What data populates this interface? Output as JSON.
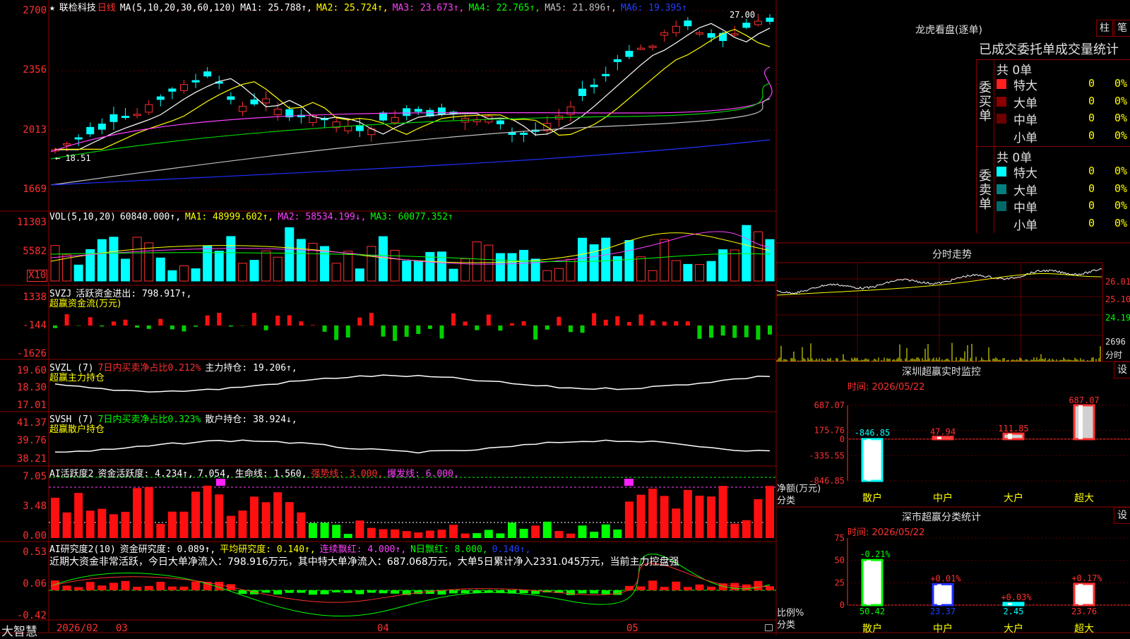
{
  "app": {
    "brand": "大智慧",
    "price_labels": {
      "main_top": "2700",
      "vol_mult": "X10"
    }
  },
  "main": {
    "star": "★",
    "name": "联检科技",
    "period": "日线",
    "ma_params": "MA(5,10,20,30,60,120)",
    "ma1": "MA1: 25.788↑,",
    "ma2": "MA2: 25.724↑,",
    "ma3": "MA3: 23.673↑,",
    "ma4": "MA4: 22.765↑,",
    "ma5": "MA5: 21.896↑,",
    "ma6": "MA6: 19.395↑",
    "yticks": [
      "2700",
      "2356",
      "2013",
      "1669"
    ],
    "high_label": "27.00",
    "low_label": "← 18.51"
  },
  "vol": {
    "params": "VOL(5,10,20)",
    "val": "60840.000↑,",
    "ma1": "MA1: 48999.602↑,",
    "ma2": "MA2: 58534.199↓,",
    "ma3": "MA3: 60077.352↑",
    "yticks": [
      "11303",
      "5582"
    ],
    "mult": "X10"
  },
  "svzj": {
    "params": "SVZJ",
    "label": "活跃资金进出: 798.917↑,",
    "sub": "超赢资金流(万元)",
    "yticks": [
      "1338",
      "-144",
      "-1626"
    ]
  },
  "svzl": {
    "params": "SVZL (7)",
    "ratio": "7日内买卖净占比0.212%",
    "hold": "主力持仓: 19.206↑,",
    "sub": "超赢主力持仓",
    "yticks": [
      "19.60",
      "18.30",
      "17.01"
    ]
  },
  "svsh": {
    "params": "SVSH (7)",
    "ratio": "7日内买卖净占比0.323%",
    "hold": "散户持仓: 38.924↓,",
    "sub": "超赢散户持仓",
    "yticks": [
      "41.37",
      "39.76",
      "38.21"
    ]
  },
  "ai1": {
    "params": "AI活跃度2",
    "active": "资金活跃度: 4.234↑,",
    "v2": "7.054,",
    "life": "生命线: 1.560,",
    "strong": "强势线: 3.000,",
    "burst": "爆发线: 6.000,",
    "yticks": [
      "7.05",
      "3.48",
      "0.00"
    ]
  },
  "ai2": {
    "params": "AI研究度2(10)",
    "research": "资金研究度: 0.089↑,",
    "avg": "平均研究度: 0.140↑,",
    "cont": "连续飘红: 4.000↑,",
    "nday": "N日飘红: 8.000,",
    "extra": "0.140↑,",
    "comment": "近期大资金非常活跃，今日大单净流入：798.916万元，其中特大单净流入：687.068万元，大单5日累计净入2331.045万元，当前主力控盘强",
    "yticks": [
      "0.53",
      "0.06",
      "-0.42"
    ]
  },
  "xaxis": {
    "labels": [
      "2026/02",
      "03",
      "04",
      "05"
    ]
  },
  "dragon": {
    "title": "龙虎看盘(逐单)",
    "btn_zhu": "柱",
    "btn_bi": "笔",
    "header": "已成交委托单成交量统计",
    "buy_side": "委买单",
    "sell_side": "委卖单",
    "buy_total": "共 0单",
    "sell_total": "共 0单",
    "buy_rows": [
      {
        "label": "特大",
        "count": "0",
        "pct": "0%",
        "color": "#ff2020"
      },
      {
        "label": "大单",
        "count": "0",
        "pct": "0%",
        "color": "#8b0000"
      },
      {
        "label": "中单",
        "count": "0",
        "pct": "0%",
        "color": "#6e0000"
      },
      {
        "label": "小单",
        "count": "0",
        "pct": "0%",
        "color": "#000000"
      }
    ],
    "sell_rows": [
      {
        "label": "特大",
        "count": "0",
        "pct": "0%",
        "color": "#00ffff"
      },
      {
        "label": "大单",
        "count": "0",
        "pct": "0%",
        "color": "#008080"
      },
      {
        "label": "中单",
        "count": "0",
        "pct": "0%",
        "color": "#006a6a"
      },
      {
        "label": "小单",
        "count": "0",
        "pct": "0%",
        "color": "#000000"
      }
    ]
  },
  "intraday": {
    "title": "分时走势",
    "yticks": [
      "26.01",
      "25.10",
      "24.19"
    ],
    "vol_label": "2696",
    "vol_unit": "分时"
  },
  "sz_monitor": {
    "title": "深圳超赢实时监控",
    "btn": "设",
    "time": "时间: 2026/05/22",
    "yticks": [
      "687.07",
      "175.76",
      "0",
      "-335.55",
      "-846.85"
    ],
    "axis_label": "净额(万元)",
    "axis_sub": "分类",
    "categories": [
      "散户",
      "中户",
      "大户",
      "超大"
    ],
    "values": [
      -846.85,
      47.94,
      111.85,
      687.07
    ],
    "value_labels": [
      "-846.85",
      "47.94",
      "111.85",
      "687.07"
    ]
  },
  "sz_class": {
    "title": "深市超赢分类统计",
    "btn": "设",
    "time": "时间: 2026/05/22",
    "yticks": [
      "75",
      "50",
      "25",
      "0"
    ],
    "axis_label": "比例%",
    "axis_sub": "分类",
    "categories": [
      "散户",
      "中户",
      "大户",
      "超大"
    ],
    "values": [
      50.42,
      23.37,
      2.45,
      23.76
    ],
    "value_labels": [
      "50.42",
      "23.37",
      "2.45",
      "23.76"
    ],
    "changes": [
      "-0.21%",
      "+0.01%",
      "+0.03%",
      "+0.17%"
    ]
  },
  "chart_data": [
    {
      "type": "bar",
      "title": "深圳超赢实时监控",
      "ylabel": "净额(万元)",
      "xlabel": "分类",
      "categories": [
        "散户",
        "中户",
        "大户",
        "超大"
      ],
      "values": [
        -846.85,
        47.94,
        111.85,
        687.07
      ],
      "ylim": [
        -846.85,
        687.07
      ]
    },
    {
      "type": "bar",
      "title": "深市超赢分类统计",
      "ylabel": "比例%",
      "xlabel": "分类",
      "categories": [
        "散户",
        "中户",
        "大户",
        "超大"
      ],
      "values": [
        50.42,
        23.37,
        2.45,
        23.76
      ],
      "ylim": [
        0,
        75
      ]
    }
  ]
}
